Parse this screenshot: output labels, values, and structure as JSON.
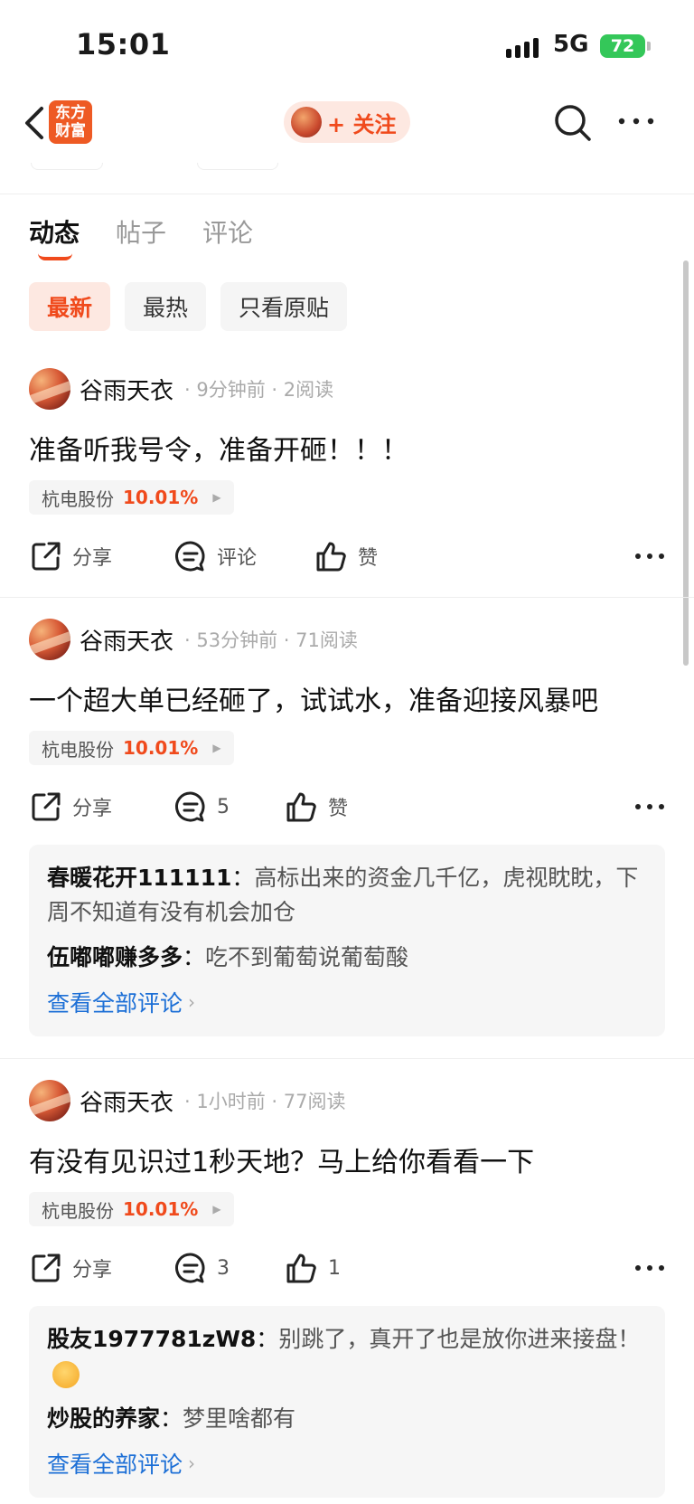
{
  "status_bar": {
    "time": "15:01",
    "network": "5G",
    "battery": "72"
  },
  "nav": {
    "logo_line1": "东方",
    "logo_line2": "财富",
    "follow_label": "+ 关注"
  },
  "tabs": [
    {
      "label": "动态",
      "active": true
    },
    {
      "label": "帖子",
      "active": false
    },
    {
      "label": "评论",
      "active": false
    }
  ],
  "filters": [
    {
      "label": "最新",
      "active": true
    },
    {
      "label": "最热",
      "active": false
    },
    {
      "label": "只看原贴",
      "active": false
    }
  ],
  "posts": [
    {
      "author": "谷雨天衣",
      "time": "9分钟前",
      "reads": "2阅读",
      "text": "准备听我号令，准备开砸！！！",
      "stock_name": "杭电股份",
      "stock_change": "10.01%",
      "share_label": "分享",
      "comment_label": "评论",
      "like_label": "赞",
      "comments": []
    },
    {
      "author": "谷雨天衣",
      "time": "53分钟前",
      "reads": "71阅读",
      "text": "一个超大单已经砸了，试试水，准备迎接风暴吧",
      "stock_name": "杭电股份",
      "stock_change": "10.01%",
      "share_label": "分享",
      "comment_label": "5",
      "like_label": "赞",
      "comments": [
        {
          "user": "春暖花开111111",
          "text": "高标出来的资金几千亿，虎视眈眈，下周不知道有没有机会加仓"
        },
        {
          "user": "伍嘟嘟赚多多",
          "text": "吃不到葡萄说葡萄酸"
        }
      ],
      "view_all": "查看全部评论"
    },
    {
      "author": "谷雨天衣",
      "time": "1小时前",
      "reads": "77阅读",
      "text": "有没有见识过1秒天地？马上给你看看一下",
      "stock_name": "杭电股份",
      "stock_change": "10.01%",
      "share_label": "分享",
      "comment_label": "3",
      "like_label": "1",
      "comments": [
        {
          "user": "股友1977781zW8",
          "text": "别跳了，真开了也是放你进来接盘！"
        },
        {
          "user": "炒股的养家",
          "text": "梦里啥都有"
        }
      ],
      "view_all": "查看全部评论"
    }
  ],
  "colors": {
    "accent": "#f04a1c",
    "link": "#1c6fd6",
    "battery": "#34c759"
  },
  "icons": [
    "back-icon",
    "search-icon",
    "more-icon",
    "share-icon",
    "comment-icon",
    "like-icon",
    "emoji-icon"
  ]
}
